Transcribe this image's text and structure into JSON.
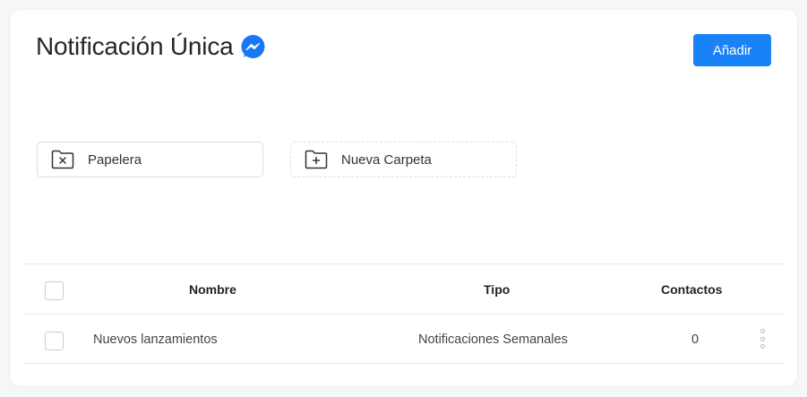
{
  "header": {
    "title": "Notificación Única",
    "title_icon": "messenger-icon",
    "add_label": "Añadir"
  },
  "folders": [
    {
      "label": "Papelera",
      "icon": "folder-x-icon"
    },
    {
      "label": "Nueva Carpeta",
      "icon": "folder-plus-icon"
    }
  ],
  "table": {
    "columns": [
      "Nombre",
      "Tipo",
      "Contactos"
    ],
    "rows": [
      {
        "nombre": "Nuevos lanzamientos",
        "tipo": "Notificaciones Semanales",
        "contactos": "0"
      }
    ]
  },
  "colors": {
    "accent": "#1a82f7",
    "messenger": "#1877f2"
  }
}
